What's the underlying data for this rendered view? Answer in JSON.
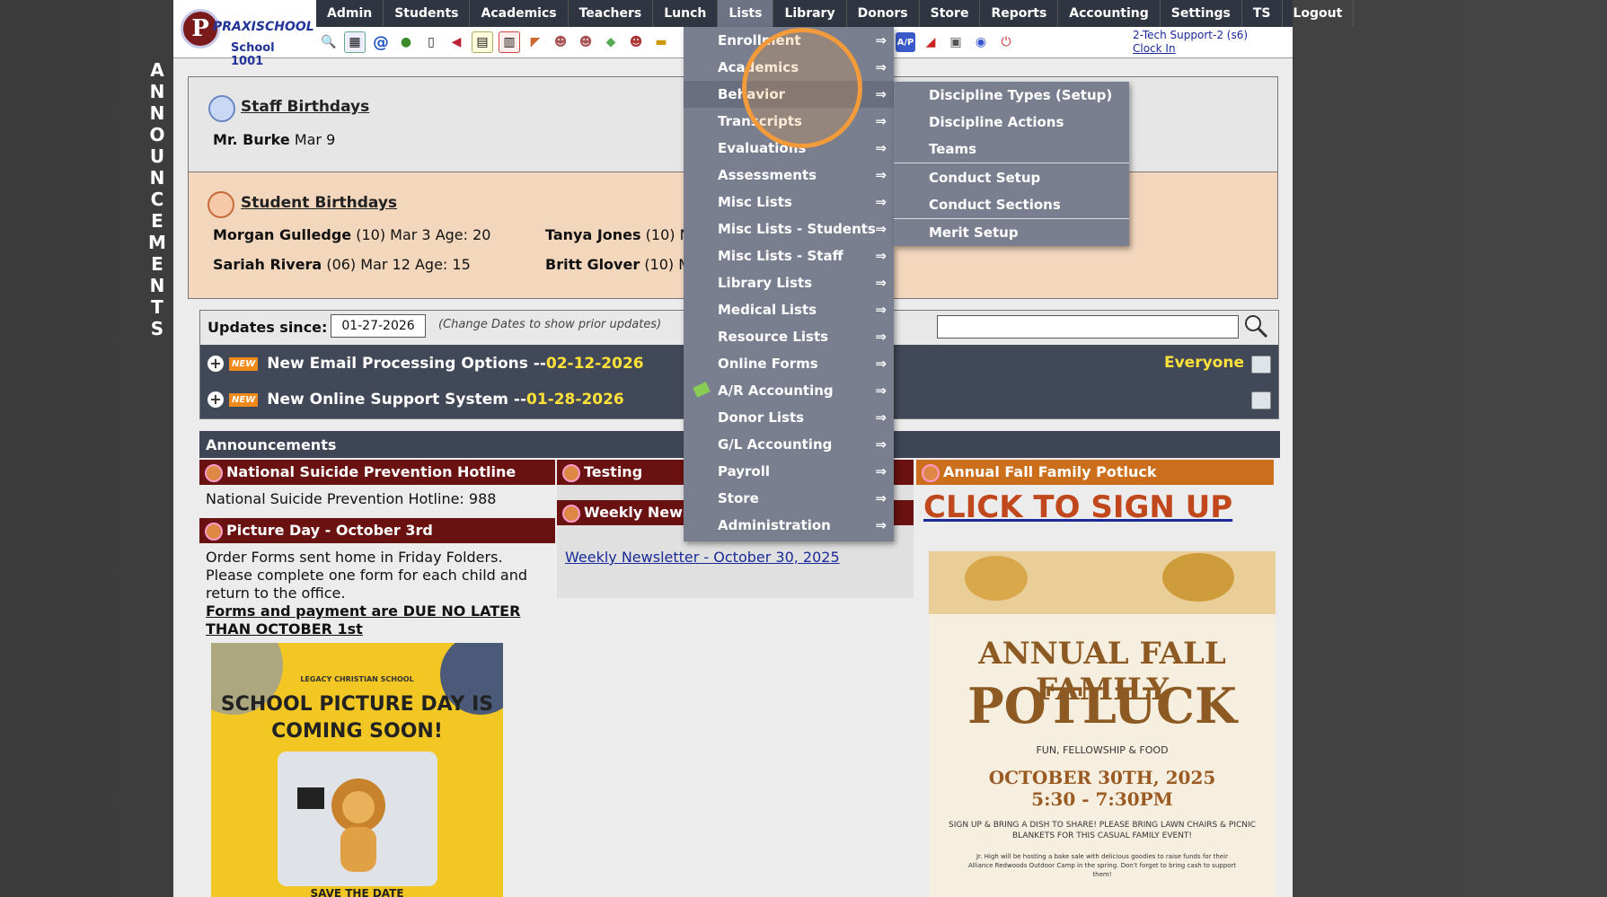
{
  "vertical_label": [
    "A",
    "N",
    "N",
    "O",
    "U",
    "N",
    "C",
    "E",
    "M",
    "E",
    "N",
    "T",
    "S"
  ],
  "logo": {
    "letter": "P",
    "name": "PRAXISCHOOL",
    "school": "School 1001"
  },
  "nav": [
    "Admin",
    "Students",
    "Academics",
    "Teachers",
    "Lunch",
    "Lists",
    "Library",
    "Donors",
    "Store",
    "Reports",
    "Accounting",
    "Settings",
    "TS",
    "Logout"
  ],
  "toolbar_icons": [
    "search-icon",
    "calendar-icon",
    "email-icon",
    "chat-icon",
    "phone-icon",
    "speaker-icon",
    "form-icon",
    "calendar2-icon",
    "megaphone-icon",
    "user-icon",
    "user2-icon",
    "money-icon",
    "people-icon",
    "cash-icon"
  ],
  "toolbar_icons_right": [
    "grid-icon",
    "ap-icon",
    "pdf-icon",
    "stack-icon",
    "help-icon",
    "power-icon"
  ],
  "toolbar_ap": "A/P",
  "user": {
    "name": "2-Tech Support-2 (s6)",
    "clock": "Clock In"
  },
  "staff_birthdays": {
    "title": "Staff Birthdays",
    "entries": [
      {
        "name": "Mr. Burke",
        "rest": "Mar 9"
      }
    ]
  },
  "student_birthdays": {
    "title": "Student Birthdays",
    "entries": [
      {
        "name": "Morgan Gulledge",
        "rest": "(10) Mar 3 Age: 20"
      },
      {
        "name": "Sariah Rivera",
        "rest": "(06) Mar 12 Age: 15"
      },
      {
        "name": "Tanya Jones",
        "rest": "(10) M"
      },
      {
        "name": "Britt Glover",
        "rest": "(10) M"
      }
    ]
  },
  "updates": {
    "label": "Updates since:",
    "date": "01-27-2026",
    "note": "(Change Dates to show prior updates)",
    "new_tag": "NEW",
    "items": [
      {
        "title": "New Email Processing Options -- ",
        "date": "02-12-2026",
        "audience": "Everyone"
      },
      {
        "title": "New Online Support System -- ",
        "date": "01-28-2026",
        "audience": ""
      }
    ]
  },
  "announcements": {
    "header": "Announcements",
    "col1": {
      "card1_title": "National Suicide Prevention Hotline",
      "card1_text": "National Suicide Prevention Hotline: 988",
      "card2_title": "Picture Day - October 3rd",
      "card2_text1": "Order Forms sent home in Friday Folders.",
      "card2_text2": "Please complete one form for each child and",
      "card2_text3": "return to the office.",
      "card2_bold1": "Forms and payment are DUE NO LATER",
      "card2_bold2": "THAN OCTOBER 1st",
      "poster_school": "LEGACY CHRISTIAN SCHOOL",
      "poster_head1": "SCHOOL PICTURE DAY IS",
      "poster_head2": "COMING SOON!",
      "poster_foot": "SAVE THE DATE"
    },
    "col2": {
      "card1_title": "Testing",
      "card2_title": "Weekly Newsl",
      "card2_link": "Weekly Newsletter - October 30, 2025"
    },
    "col3": {
      "card1_title": "Annual Fall Family Potluck",
      "signup": "CLICK TO SIGN UP",
      "poster_line1": "ANNUAL FALL FAMILY",
      "poster_line2": "POTLUCK",
      "poster_sub": "FUN, FELLOWSHIP & FOOD",
      "poster_date": "OCTOBER 30TH, 2025",
      "poster_time": "5:30 - 7:30PM",
      "poster_info1": "SIGN UP & BRING A DISH TO SHARE! PLEASE BRING LAWN CHAIRS & PICNIC",
      "poster_info2": "BLANKETS FOR THIS CASUAL FAMILY EVENT!",
      "poster_info3": "Jr. High will be hosting a bake sale with delicious goodies to raise funds for their",
      "poster_info4": "Alliance Redwoods Outdoor Camp in the spring. Don't forget to bring cash to support",
      "poster_info5": "them!"
    }
  },
  "lists_menu": {
    "arrow": "⇒",
    "items": [
      "Enrollment",
      "Academics",
      "Behavior",
      "Transcripts",
      "Evaluations",
      "Assessments",
      "Misc Lists",
      "Misc Lists - Students",
      "Misc Lists - Staff",
      "Library Lists",
      "Medical Lists",
      "Resource Lists",
      "Online Forms",
      "A/R Accounting",
      "Donor Lists",
      "G/L Accounting",
      "Payroll",
      "Store",
      "Administration"
    ],
    "highlighted": "Behavior"
  },
  "behavior_submenu": [
    "Discipline Types (Setup)",
    "Discipline Actions",
    "Teams",
    "Conduct Setup",
    "Conduct Sections",
    "Merit Setup"
  ],
  "colors": {
    "nav_bg": "#2f3642",
    "menu_bg": "#7a7f90",
    "highlight_circle": "#f39a3a",
    "maroon": "#6a1212",
    "orange": "#cc6f1c",
    "yellow": "#ffe13a"
  }
}
